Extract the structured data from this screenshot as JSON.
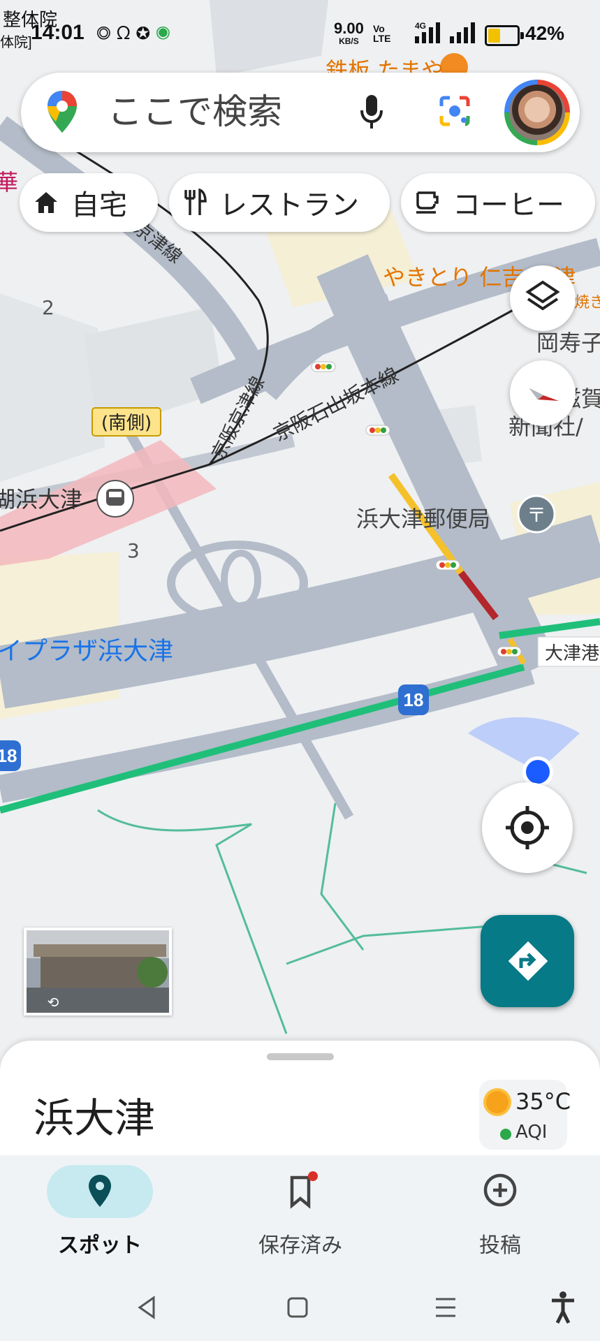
{
  "status_bar": {
    "notif_text_top": "整体院",
    "notif_text_bottom": "体院]",
    "time": "14:01",
    "net_speed": "9.00",
    "net_speed_unit": "KB/S",
    "volte": "Vo LTE",
    "net_type": "4G",
    "battery": "42%",
    "battery_level": 0.42
  },
  "search": {
    "placeholder": "ここで検索"
  },
  "chips": [
    {
      "label": "自宅",
      "icon": "home-icon"
    },
    {
      "label": "レストラン",
      "icon": "restaurant-icon"
    },
    {
      "label": "コーヒー",
      "icon": "coffee-icon"
    }
  ],
  "map": {
    "labels": {
      "restaurant_1": "鉄板 たまや",
      "restaurant_2": "やきとり 仁吉 大津",
      "restaurant_2_sub": "焼き",
      "rail_1": "京津線",
      "rail_2": "京阪京津線",
      "rail_3": "京阪石山坂本線",
      "station_side": "(南側)",
      "station": "湖浜大津",
      "block_2": "2",
      "block_3": "3",
      "post_office": "浜大津郵便局",
      "shop_1": "岡寿子",
      "shop_2": "滋賀",
      "newspaper": "新聞社/",
      "mall": "イプラザ浜大津",
      "port": "大津港",
      "route_1": "18",
      "route_2": "18",
      "pink_char": "華"
    }
  },
  "colors": {
    "accent": "#077a87",
    "traffic_green": "#1fbf7a",
    "traffic_red": "#b3262b",
    "traffic_yellow": "#f5c12b",
    "location_blue": "#1a5cff",
    "route_shield": "#2e6fd1",
    "place_blue": "#1a73e8",
    "restaurant_orange": "#e37400"
  },
  "sheet": {
    "title": "浜大津",
    "weather_temp": "35°C",
    "aqi_label": "AQI"
  },
  "bottom_nav": [
    {
      "label": "スポット",
      "icon": "explore-pin-icon",
      "active": true
    },
    {
      "label": "保存済み",
      "icon": "bookmark-icon",
      "active": false
    },
    {
      "label": "投稿",
      "icon": "add-circle-icon",
      "active": false
    }
  ]
}
